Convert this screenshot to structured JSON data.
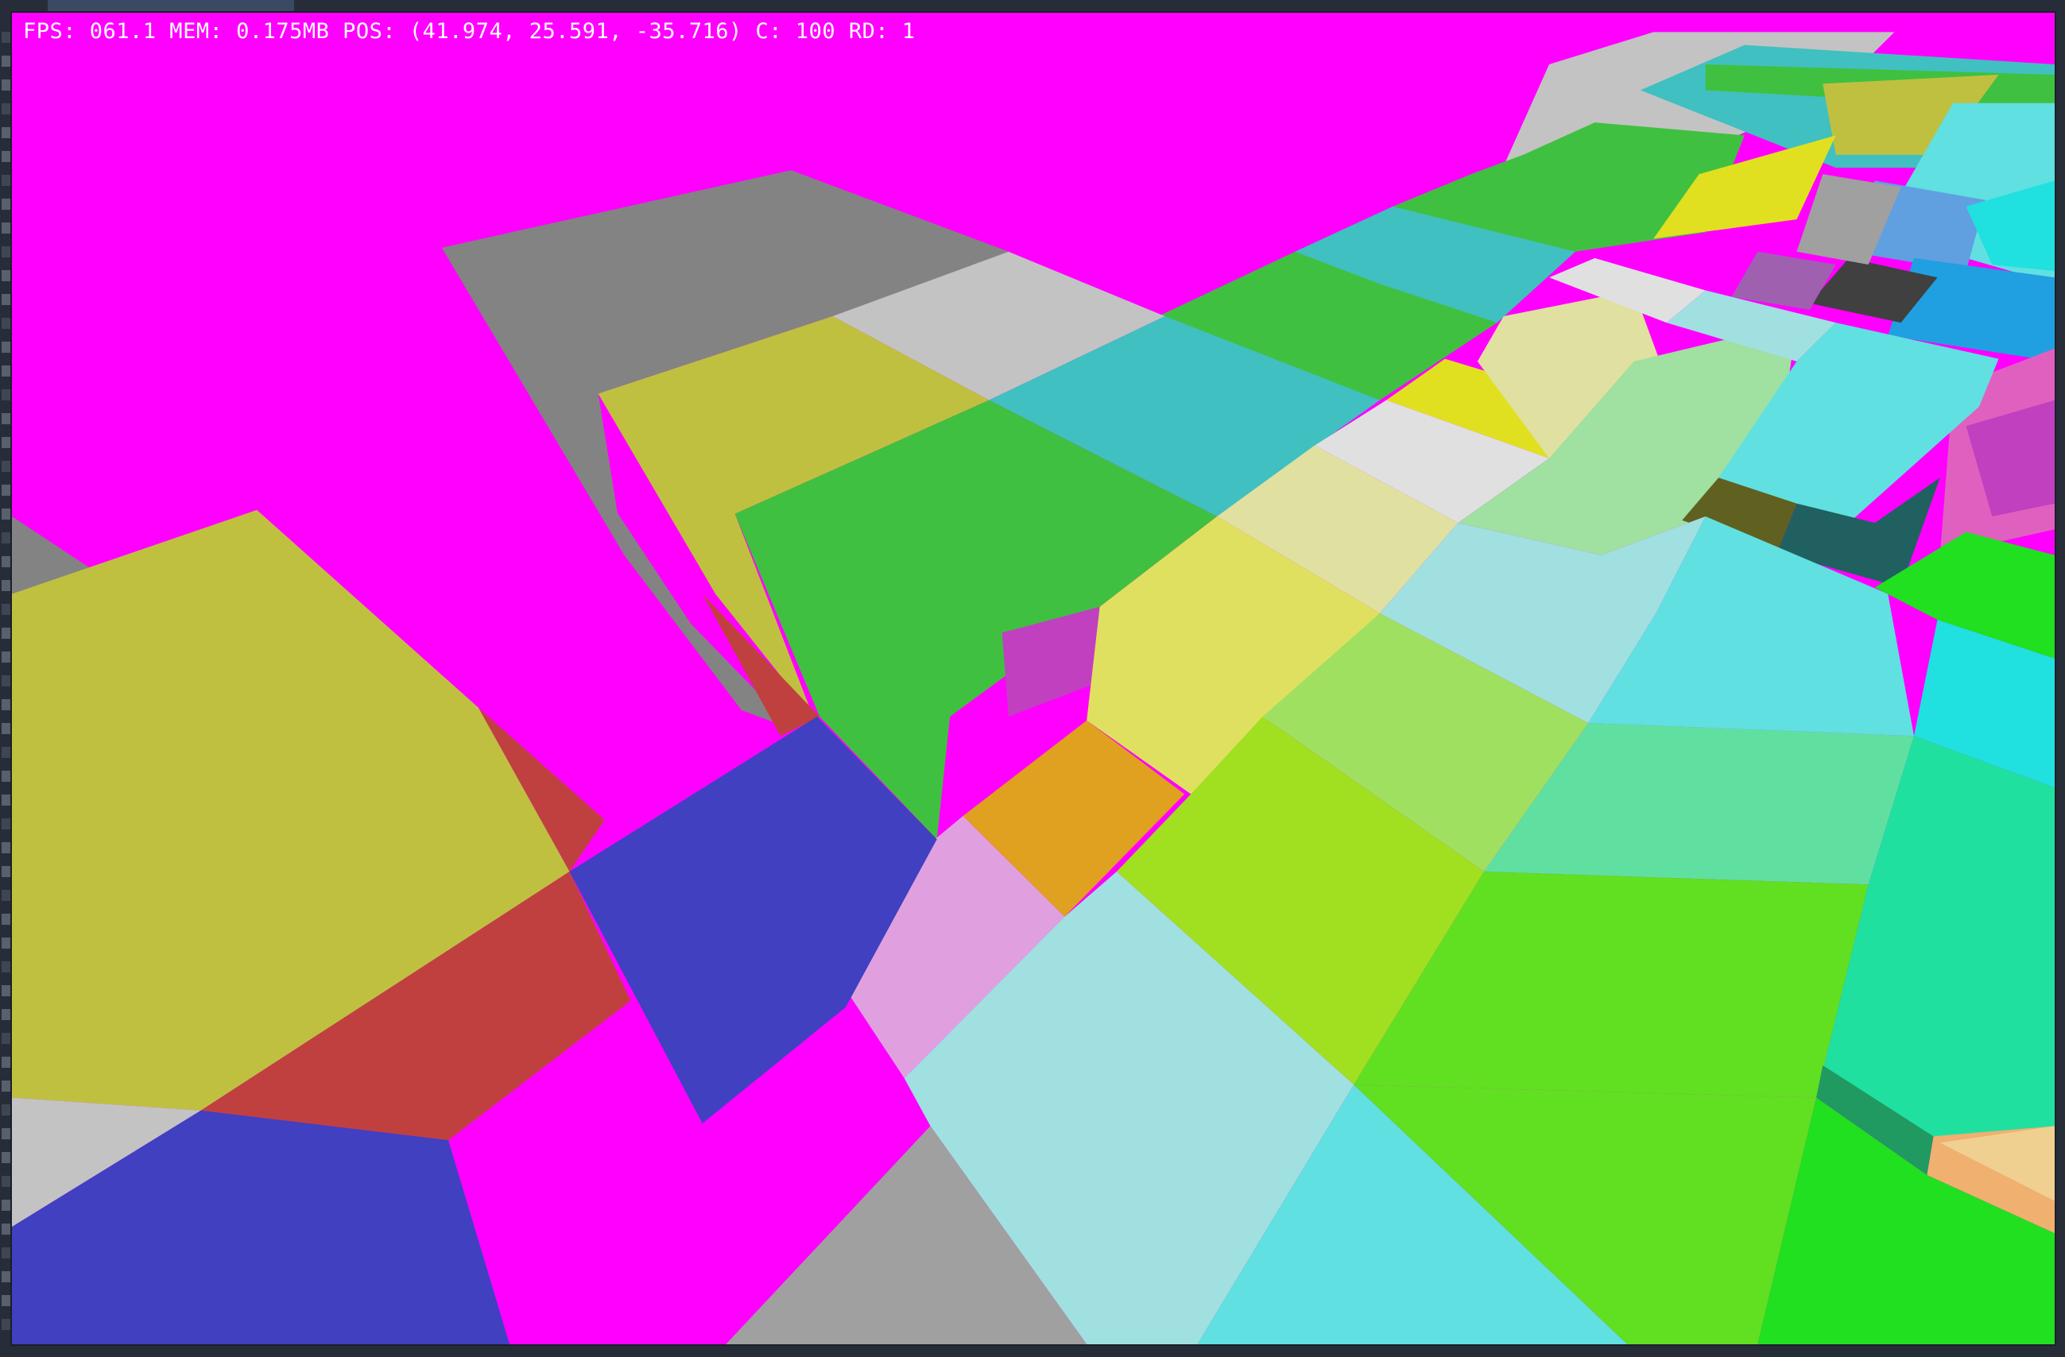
{
  "hud": {
    "stats": "FPS: 061.1 MEM: 0.175MB POS: (41.974, 25.591, -35.716) C: 100 RD: 1"
  },
  "colors": {
    "sky": "#ff00ff",
    "grey": "#838383",
    "light_grey": "#c3c3c3",
    "olive": "#c0c040",
    "green": "#40c040",
    "teal": "#40c0c0",
    "yellow": "#e0e020",
    "blue": "#4040c0",
    "red": "#c04040",
    "orange": "#e0a020",
    "pink": "#e0a0e0",
    "pale_cyan": "#a0e0e0",
    "cyan": "#60e0e0",
    "lime": "#a0e020",
    "bright_green": "#60e020",
    "neon_green": "#20e020",
    "sea_green": "#20e0a0",
    "dark_grey": "#404040",
    "peach": "#f0b070"
  }
}
